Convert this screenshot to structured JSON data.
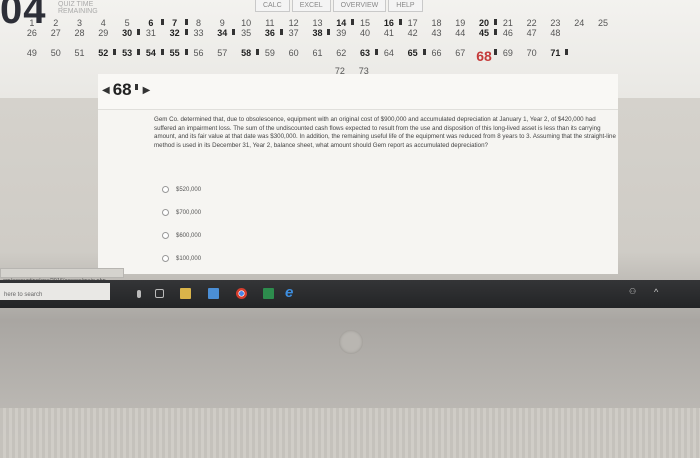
{
  "timer": {
    "digits": "04",
    "caption": "QUIZ TIME REMAINING"
  },
  "top_tabs": [
    "CALC",
    "EXCEL",
    "OVERVIEW",
    "HELP"
  ],
  "question_nav": {
    "rows": [
      [
        {
          "n": "1",
          "a": false
        },
        {
          "n": "2",
          "a": false
        },
        {
          "n": "3",
          "a": false
        },
        {
          "n": "4",
          "a": false
        },
        {
          "n": "5",
          "a": false
        },
        {
          "n": "6",
          "a": true
        },
        {
          "n": "7",
          "a": true
        },
        {
          "n": "8",
          "a": false
        },
        {
          "n": "9",
          "a": false
        },
        {
          "n": "10",
          "a": false
        },
        {
          "n": "11",
          "a": false
        },
        {
          "n": "12",
          "a": false
        },
        {
          "n": "13",
          "a": false
        },
        {
          "n": "14",
          "a": true
        },
        {
          "n": "15",
          "a": false
        },
        {
          "n": "16",
          "a": true
        },
        {
          "n": "17",
          "a": false
        },
        {
          "n": "18",
          "a": false
        },
        {
          "n": "19",
          "a": false
        },
        {
          "n": "20",
          "a": true
        },
        {
          "n": "21",
          "a": false
        },
        {
          "n": "22",
          "a": false
        },
        {
          "n": "23",
          "a": false
        },
        {
          "n": "24",
          "a": false
        },
        {
          "n": "25",
          "a": false
        }
      ],
      [
        {
          "n": "26",
          "a": false
        },
        {
          "n": "27",
          "a": false
        },
        {
          "n": "28",
          "a": false
        },
        {
          "n": "29",
          "a": false
        },
        {
          "n": "30",
          "a": true
        },
        {
          "n": "31",
          "a": false
        },
        {
          "n": "32",
          "a": true
        },
        {
          "n": "33",
          "a": false
        },
        {
          "n": "34",
          "a": true
        },
        {
          "n": "35",
          "a": false
        },
        {
          "n": "36",
          "a": true
        },
        {
          "n": "37",
          "a": false
        },
        {
          "n": "38",
          "a": true
        },
        {
          "n": "39",
          "a": false
        },
        {
          "n": "40",
          "a": false
        },
        {
          "n": "41",
          "a": false
        },
        {
          "n": "42",
          "a": false
        },
        {
          "n": "43",
          "a": false
        },
        {
          "n": "44",
          "a": false
        },
        {
          "n": "45",
          "a": true
        },
        {
          "n": "46",
          "a": false
        },
        {
          "n": "47",
          "a": false
        },
        {
          "n": "48",
          "a": false
        }
      ],
      [
        {
          "n": "49",
          "a": false
        },
        {
          "n": "50",
          "a": false
        },
        {
          "n": "51",
          "a": false
        },
        {
          "n": "52",
          "a": true
        },
        {
          "n": "53",
          "a": true
        },
        {
          "n": "54",
          "a": true
        },
        {
          "n": "55",
          "a": true
        },
        {
          "n": "56",
          "a": false
        },
        {
          "n": "57",
          "a": false
        },
        {
          "n": "58",
          "a": true
        },
        {
          "n": "59",
          "a": false
        },
        {
          "n": "60",
          "a": false
        },
        {
          "n": "61",
          "a": false
        },
        {
          "n": "62",
          "a": false
        },
        {
          "n": "63",
          "a": true
        },
        {
          "n": "64",
          "a": false
        },
        {
          "n": "65",
          "a": true
        },
        {
          "n": "66",
          "a": false
        },
        {
          "n": "67",
          "a": false
        },
        {
          "n": "68",
          "a": true,
          "current": true
        },
        {
          "n": "69",
          "a": false
        },
        {
          "n": "70",
          "a": false
        },
        {
          "n": "71",
          "a": true
        }
      ],
      [
        {
          "n": "72",
          "a": false
        },
        {
          "n": "73",
          "a": false
        }
      ]
    ]
  },
  "question": {
    "number": "68",
    "text": "Gem Co. determined that, due to obsolescence, equipment with an original cost of $900,000 and accumulated depreciation at January 1, Year 2, of $420,000 had suffered an impairment loss. The sum of the undiscounted cash flows expected to result from the use and disposition of this long-lived asset is less than its carrying amount, and its fair value at that date was $300,000. In addition, the remaining useful life of the equipment was reduced from 8 years to 3. Assuming that the straight-line method is used in its December 31, Year 2, balance sheet, what amount should Gem report as accumulated depreciation?",
    "options": [
      "$520,000",
      "$700,000",
      "$600,000",
      "$100,000"
    ]
  },
  "address_bar": {
    "url": "om/accounting/cpa/2016/assess/main.php"
  },
  "taskbar": {
    "search_placeholder": "here to search"
  }
}
